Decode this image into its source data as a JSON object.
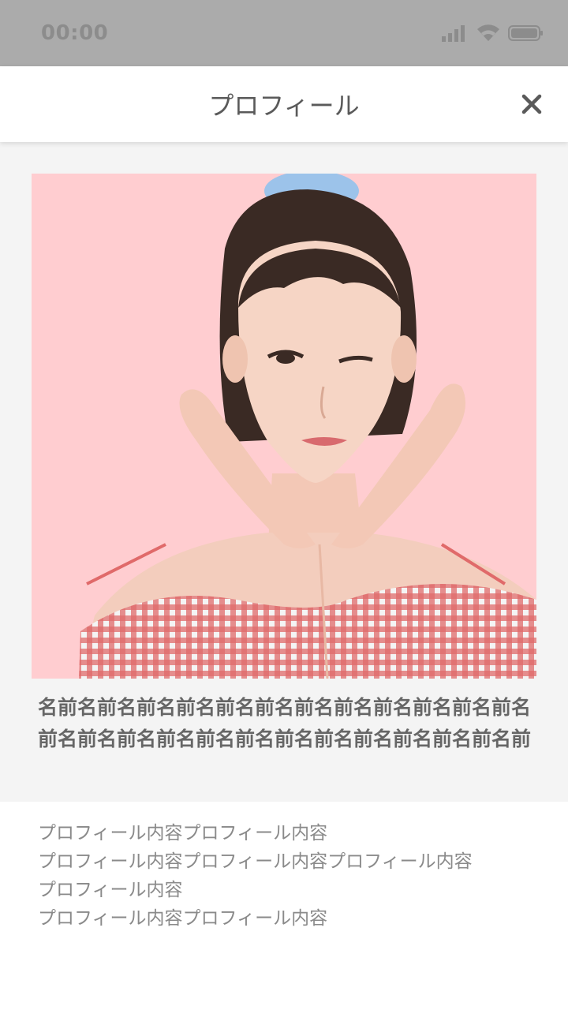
{
  "status_bar": {
    "time": "00:00",
    "icons": [
      "signal-icon",
      "wifi-icon",
      "battery-icon"
    ]
  },
  "header": {
    "title": "プロフィール",
    "close_icon": "close-icon"
  },
  "profile": {
    "photo": "profile-photo",
    "name": "名前名前名前名前名前名前名前名前名前名前名前名前名前名前名前名前名前名前名前名前名前名前名前名前名前",
    "content_lines": [
      "プロフィール内容プロフィール内容",
      "プロフィール内容プロフィール内容プロフィール内容",
      "プロフィール内容",
      "プロフィール内容プロフィール内容"
    ]
  },
  "colors": {
    "status_bar": "#ababab",
    "photo_background": "#ffcdd0",
    "name_text": "#666666",
    "content_text": "#8a8a8a"
  }
}
